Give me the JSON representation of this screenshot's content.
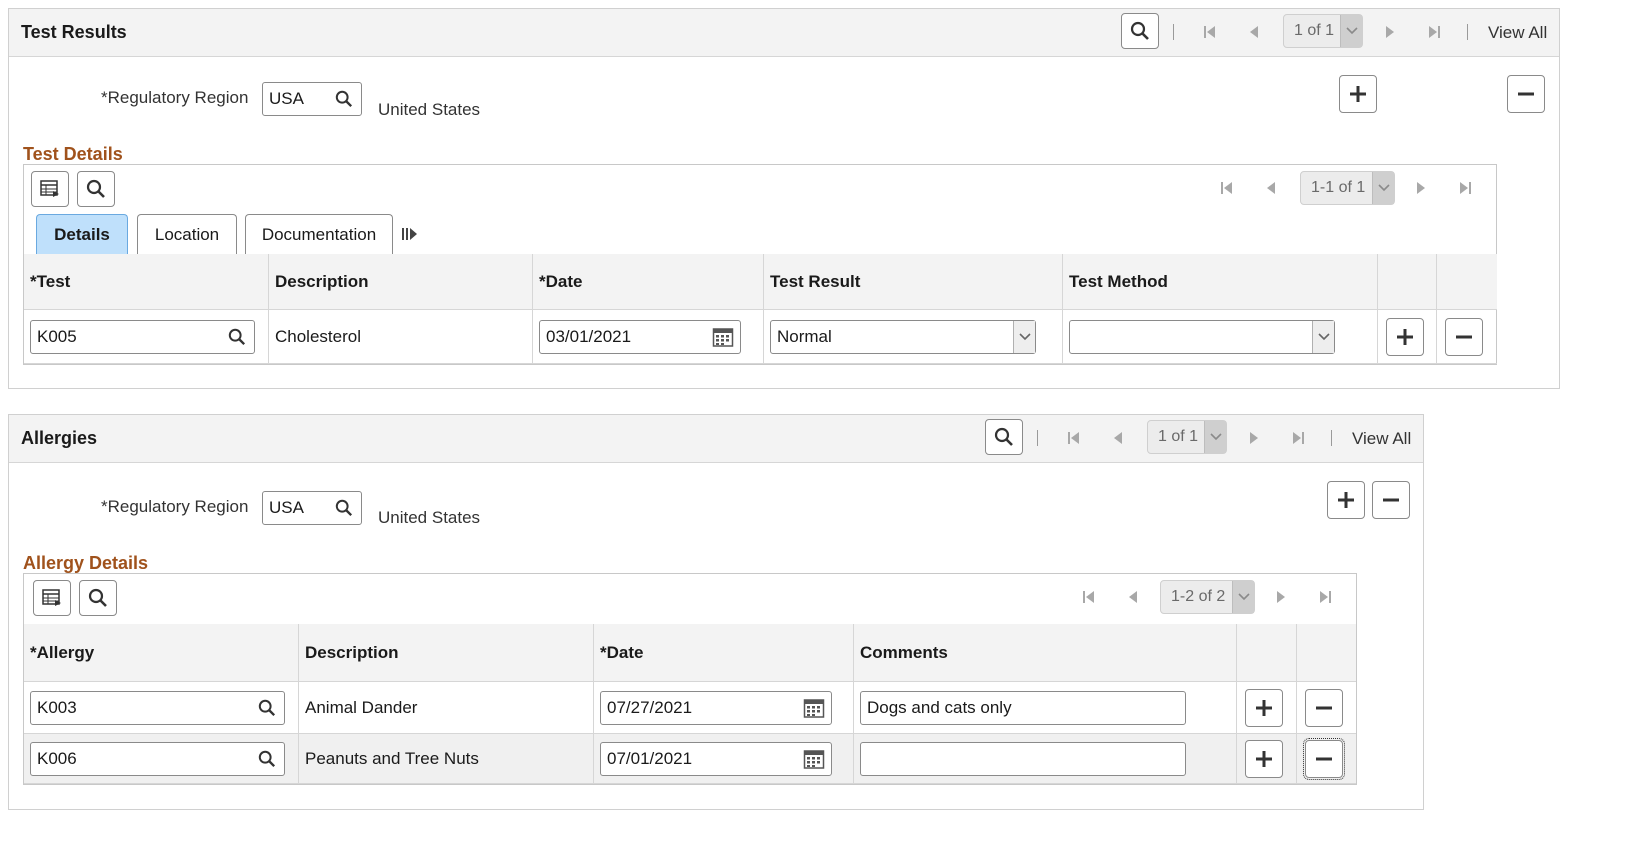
{
  "test_results": {
    "title": "Test Results",
    "pager": "1 of 1",
    "view_all": "View All",
    "region_label": "*Regulatory Region",
    "region_value": "USA",
    "region_desc": "United States",
    "details": {
      "title": "Test Details",
      "pager": "1-1 of 1",
      "tabs": [
        {
          "label": "Details",
          "active": true
        },
        {
          "label": "Location",
          "active": false
        },
        {
          "label": "Documentation",
          "active": false
        }
      ],
      "columns": [
        "*Test",
        "Description",
        "*Date",
        "Test Result",
        "Test Method"
      ],
      "rows": [
        {
          "test": "K005",
          "description": "Cholesterol",
          "date": "03/01/2021",
          "result": "Normal",
          "method": ""
        }
      ]
    }
  },
  "allergies": {
    "title": "Allergies",
    "pager": "1 of 1",
    "view_all": "View All",
    "region_label": "*Regulatory Region",
    "region_value": "USA",
    "region_desc": "United States",
    "details": {
      "title": "Allergy Details",
      "pager": "1-2 of 2",
      "columns": [
        "*Allergy",
        "Description",
        "*Date",
        "Comments"
      ],
      "rows": [
        {
          "allergy": "K003",
          "description": "Animal Dander",
          "date": "07/27/2021",
          "comments": "Dogs and cats only"
        },
        {
          "allergy": "K006",
          "description": "Peanuts and Tree Nuts",
          "date": "07/01/2021",
          "comments": ""
        }
      ]
    }
  },
  "colors": {
    "section_title": "#a0521c",
    "active_tab": "#bfe0fb",
    "header_bg": "#f3f3f3"
  },
  "icons": [
    "search-icon",
    "first-page-icon",
    "prev-page-icon",
    "next-page-icon",
    "last-page-icon",
    "add-icon",
    "delete-icon",
    "calendar-icon",
    "grid-personalize-icon",
    "chevron-down-icon",
    "show-all-columns-icon"
  ]
}
